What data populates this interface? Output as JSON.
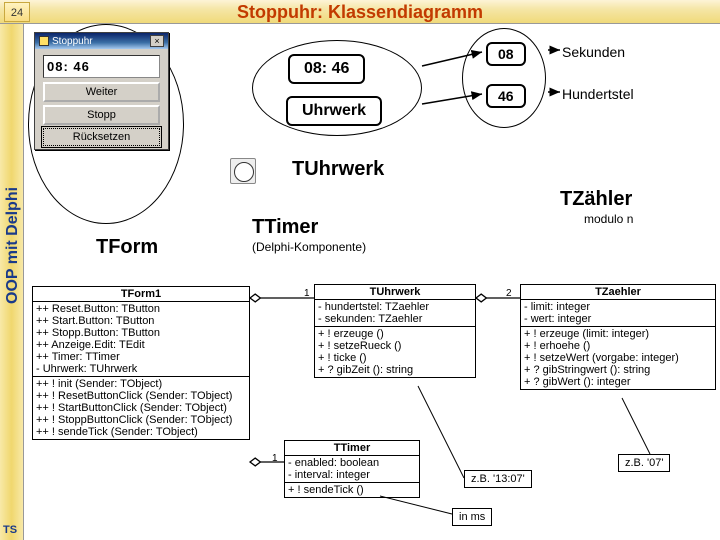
{
  "page": {
    "num": "24",
    "title": "Stoppuhr: Klassendiagramm"
  },
  "sidebar": {
    "text": "OOP mit Delphi",
    "ts": "TS"
  },
  "win": {
    "title": "Stoppuhr",
    "close": "×",
    "display": "08: 46",
    "btnWeiter": "Weiter",
    "btnStopp": "Stopp",
    "btnReset": "Rücksetzen"
  },
  "objs": {
    "disp": "08: 46",
    "uhr": "Uhrwerk",
    "sek": "08",
    "hund": "46",
    "lblSek": "Sekunden",
    "lblHund": "Hundertstel"
  },
  "classes": {
    "tuhr": "TUhrwerk",
    "tform": "TForm",
    "ttimer": "TTimer",
    "ttimerSub": "(Delphi-Komponente)",
    "tzaehler": "TZähler",
    "modn": "modulo n"
  },
  "notes": {
    "ex1307": "z.B. '13:07'",
    "ex07": "z.B. '07'",
    "inms": "in ms"
  },
  "assoc": {
    "one": "1",
    "two": "2"
  },
  "uml": {
    "tform1": {
      "name": "TForm1",
      "attrs": "++ Reset.Button: TButton\n++ Start.Button: TButton\n++ Stopp.Button: TButton\n++ Anzeige.Edit: TEdit\n++ Timer: TTimer\n- Uhrwerk: TUhrwerk",
      "ops": "++ ! init (Sender: TObject)\n++ ! ResetButtonClick (Sender: TObject)\n++ ! StartButtonClick (Sender: TObject)\n++ ! StoppButtonClick (Sender: TObject)\n++ ! sendeTick (Sender: TObject)"
    },
    "tuhrwerk": {
      "name": "TUhrwerk",
      "attrs": "- hundertstel: TZaehler\n- sekunden: TZaehler",
      "ops": "+ ! erzeuge ()\n+ ! setzeRueck ()\n+ ! ticke ()\n+ ? gibZeit (): string"
    },
    "ttimer": {
      "name": "TTimer",
      "attrs": "- enabled: boolean\n- interval: integer",
      "ops": "+ ! sendeTick ()"
    },
    "tzaehler": {
      "name": "TZaehler",
      "attrs": "- limit: integer\n- wert: integer",
      "ops": "+ ! erzeuge (limit: integer)\n+ ! erhoehe ()\n+ ! setzeWert (vorgabe: integer)\n+ ? gibStringwert (): string\n+ ? gibWert (): integer"
    }
  }
}
